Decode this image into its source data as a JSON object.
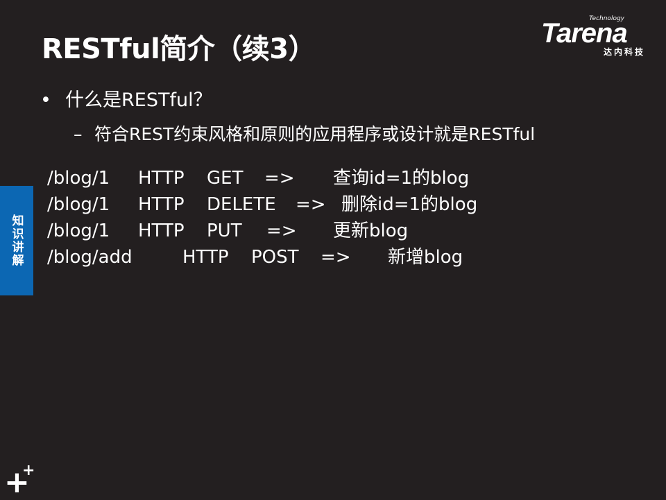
{
  "slide": {
    "title": "RESTful简介（续3）"
  },
  "logo": {
    "small_text": "Technology",
    "brand": "Tarena",
    "cn_text": "达内科技"
  },
  "bullet": {
    "symbol": "•",
    "text": "什么是RESTful？"
  },
  "sub_bullet": {
    "symbol": "–",
    "text": "符合REST约束风格和原则的应用程序或设计就是RESTful"
  },
  "side_tab": {
    "label": "知识讲解",
    "color": "#0c67b3"
  },
  "routes": [
    {
      "path": "/blog/1",
      "protocol": "HTTP",
      "method": "GET",
      "arrow": "=>",
      "desc": "查询id=1的blog"
    },
    {
      "path": "/blog/1",
      "protocol": "HTTP",
      "method": "DELETE",
      "arrow": "=>",
      "desc": "删除id=1的blog"
    },
    {
      "path": "/blog/1",
      "protocol": "HTTP",
      "method": "PUT",
      "arrow": "=>",
      "desc": "更新blog"
    },
    {
      "path": "/blog/add",
      "protocol": "HTTP",
      "method": "POST",
      "arrow": "=>",
      "desc": "新增blog"
    }
  ],
  "decor": {
    "plus_big": "+",
    "plus_small": "+"
  },
  "colors": {
    "background": "#231f20",
    "text": "#ffffff"
  }
}
